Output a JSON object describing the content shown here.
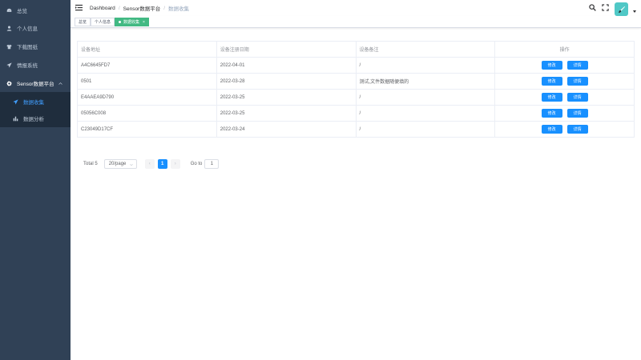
{
  "sidebar": {
    "items": [
      {
        "label": "总览",
        "icon": "dashboard-icon"
      },
      {
        "label": "个人信息",
        "icon": "user-icon"
      },
      {
        "label": "下载图纸",
        "icon": "shirt-icon"
      },
      {
        "label": "情报系统",
        "icon": "send-icon"
      },
      {
        "label": "Sensor数据平台",
        "icon": "gear-icon"
      }
    ],
    "submenu": [
      {
        "label": "数据收集",
        "icon": "send-icon"
      },
      {
        "label": "数据分析",
        "icon": "bar-chart-icon"
      }
    ]
  },
  "navbar": {
    "breadcrumb": [
      "Dashboard",
      "Sensor数据平台",
      "数据收集"
    ]
  },
  "tags": [
    "总览",
    "个人信息",
    "数据收集"
  ],
  "table": {
    "headers": [
      "设备地址",
      "设备注册日期",
      "设备备注",
      "操作"
    ],
    "rows": [
      [
        "A4C6645FD7",
        "2022-04-01",
        "/"
      ],
      [
        "0501",
        "2022-03-28",
        "测试,文件数据随便填的"
      ],
      [
        "E4AAEA9D790",
        "2022-03-25",
        "/"
      ],
      [
        "05056C008",
        "2022-03-25",
        "/"
      ],
      [
        "C23049D17CF",
        "2022-03-24",
        "/"
      ]
    ],
    "edit_label": "修改",
    "detail_label": "详情"
  },
  "pagination": {
    "total": "Total 5",
    "page_size": "20/page",
    "current_page": "1",
    "goto_label": "Go to",
    "goto_value": "1"
  },
  "colors": {
    "sidebar_bg": "#304156",
    "accent": "#1890ff",
    "tag_active": "#42b983",
    "avatar_bg": "#50c8c6"
  }
}
